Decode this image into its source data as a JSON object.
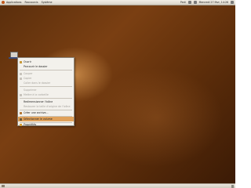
{
  "top_panel": {
    "menus": [
      {
        "label": "Applications"
      },
      {
        "label": "Raccourcis"
      },
      {
        "label": "Système"
      }
    ],
    "user": "Pedi",
    "datetime": "Mercredi 27 févr, 14:26"
  },
  "context_menu": {
    "items": [
      {
        "label": "Ouvrir",
        "icon": "folder-icon",
        "enabled": true,
        "highlighted": false
      },
      {
        "label": "Parcourir le dossier",
        "icon": "none",
        "enabled": true,
        "highlighted": false
      },
      {
        "label": "Couper",
        "icon": "cut-icon",
        "enabled": false,
        "highlighted": false
      },
      {
        "label": "Copier",
        "icon": "copy-icon",
        "enabled": false,
        "highlighted": false
      },
      {
        "label": "Coller dans le dossier",
        "icon": "none",
        "enabled": false,
        "highlighted": false
      },
      {
        "label": "Supprimer",
        "icon": "none",
        "enabled": false,
        "highlighted": false
      },
      {
        "label": "Mettre à la corbeille",
        "icon": "trash-icon",
        "enabled": false,
        "highlighted": false
      },
      {
        "label": "Redimensionner l'icône",
        "icon": "none",
        "enabled": true,
        "highlighted": false
      },
      {
        "label": "Restaurer la taille d'origine de l'icône",
        "icon": "none",
        "enabled": false,
        "highlighted": false
      },
      {
        "label": "Créer une archive…",
        "icon": "archive-icon",
        "enabled": true,
        "highlighted": false
      },
      {
        "label": "Sélectionner le volume",
        "icon": "eject-icon",
        "enabled": true,
        "highlighted": true
      },
      {
        "label": "Propriétés",
        "icon": "properties-icon",
        "enabled": true,
        "highlighted": false
      }
    ]
  },
  "colors": {
    "desktop_base": "#5a2e0c",
    "menu_highlight": "#e0a15a",
    "panel": "#e6e1d8"
  }
}
